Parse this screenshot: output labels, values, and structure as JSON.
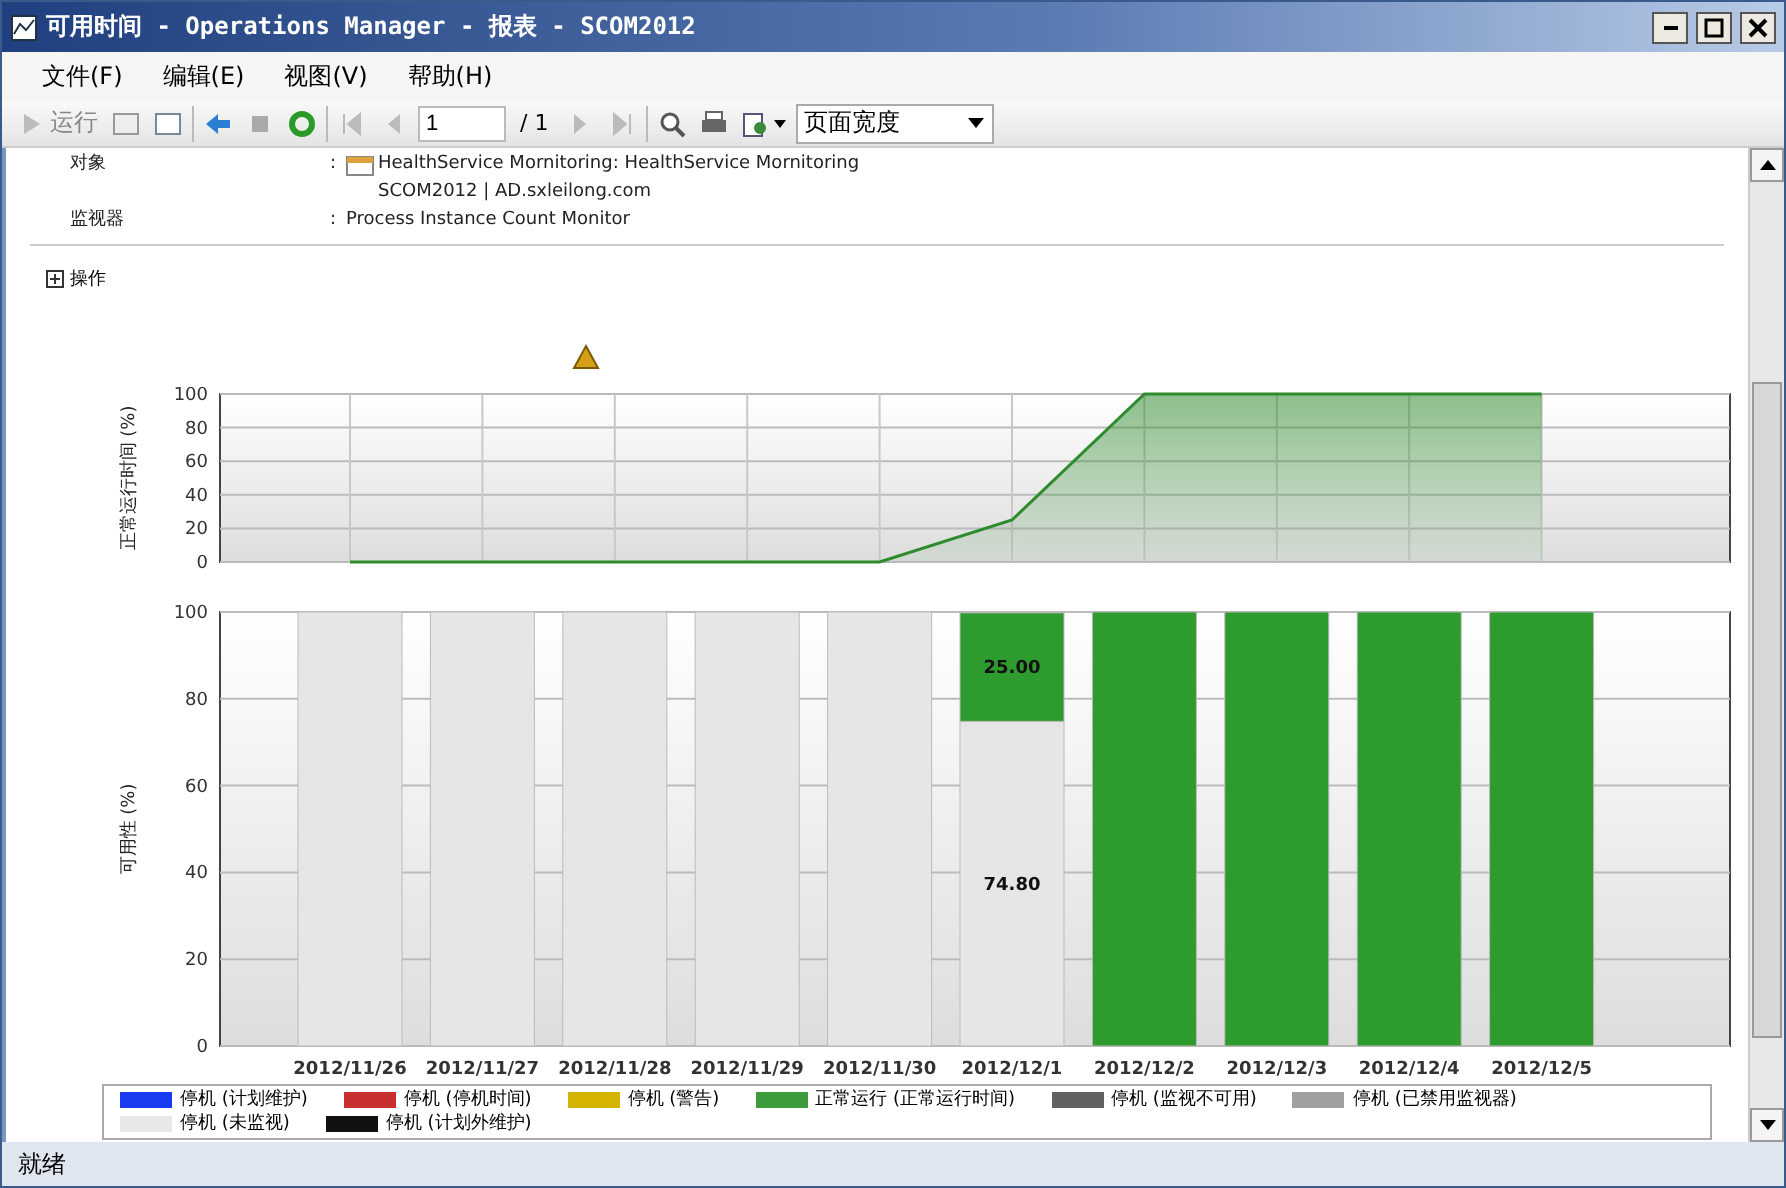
{
  "window": {
    "title": "可用时间 - Operations Manager - 报表 - SCOM2012"
  },
  "menu": [
    "文件(F)",
    "编辑(E)",
    "视图(V)",
    "帮助(H)"
  ],
  "toolbar": {
    "run_label": "运行",
    "page_value": "1",
    "page_total": "/ 1",
    "zoom": "页面宽度"
  },
  "details": [
    {
      "label": "对象",
      "separator": ":",
      "lines": [
        "HealthService Mornitoring: HealthService Mornitoring",
        "SCOM2012 | AD.sxleilong.com"
      ]
    },
    {
      "label": "监视器",
      "separator": ":",
      "lines": [
        "Process Instance Count Monitor"
      ]
    }
  ],
  "actions": {
    "label": "操作",
    "expanded": false
  },
  "uptime_chart": {
    "chart_data": {
      "type": "area",
      "ylabel": "正常运行时间 (%)",
      "grid": true,
      "ylim": [
        0,
        100
      ],
      "yticks": [
        0,
        20,
        40,
        60,
        80,
        100
      ],
      "series": [
        {
          "color": "#2e8b2e",
          "values": [
            0,
            0,
            0,
            0,
            0,
            25,
            100,
            100,
            100,
            100
          ]
        }
      ]
    }
  },
  "availability_chart": {
    "chart_data": {
      "type": "bar",
      "stacked": true,
      "grid": true,
      "ylabel": "可用性 (%)",
      "categories": [
        "2012/11/26",
        "2012/11/27",
        "2012/11/28",
        "2012/11/29",
        "2012/11/30",
        "2012/12/1",
        "2012/12/2",
        "2012/12/3",
        "2012/12/4",
        "2012/12/5"
      ],
      "ylim": [
        0,
        100
      ],
      "yticks": [
        0,
        20,
        40,
        60,
        80,
        100
      ],
      "series": [
        {
          "color": "#e6e6e6",
          "values": [
            100,
            100,
            100,
            100,
            100,
            74.8,
            0,
            0,
            0,
            0
          ]
        },
        {
          "color": "#2e9b2e",
          "values": [
            0,
            0,
            0,
            0,
            0,
            25,
            100,
            100,
            100,
            100
          ]
        }
      ],
      "annotations": [
        "25.00",
        "74.80"
      ]
    }
  },
  "legend": {
    "items": [
      {
        "label": "停机 (计划维护)",
        "color": "#1a3cf0"
      },
      {
        "label": "停机 (停机时间)",
        "color": "#c83030"
      },
      {
        "label": "停机 (警告)",
        "color": "#d4b400"
      },
      {
        "label": "正常运行 (正常运行时间)",
        "color": "#3c9c3c"
      },
      {
        "label": "停机 (监视不可用)",
        "color": "#606060"
      },
      {
        "label": "停机 (已禁用监视器)",
        "color": "#a0a0a0"
      },
      {
        "label": "停机 (未监视)",
        "color": "#e8e8e8"
      },
      {
        "label": "停机 (计划外维护)",
        "color": "#101010"
      }
    ]
  },
  "status_bar": "就绪"
}
